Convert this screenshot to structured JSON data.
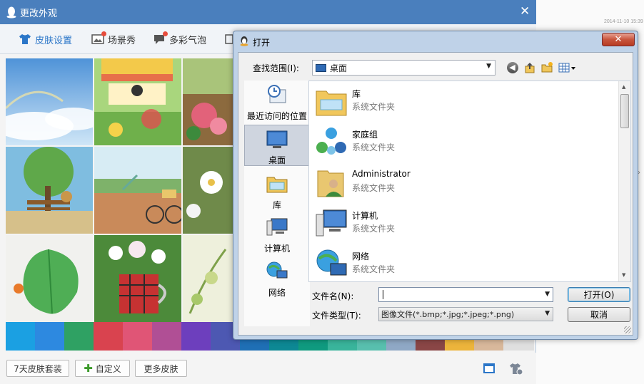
{
  "skin_window": {
    "title": "更改外观",
    "tabs": [
      {
        "label": "皮肤设置"
      },
      {
        "label": "场景秀"
      },
      {
        "label": "多彩气泡"
      }
    ],
    "bottom_buttons": {
      "seven_day": "7天皮肤套装",
      "custom": "自定义",
      "more": "更多皮肤"
    },
    "colors": [
      "#1ba0e2",
      "#2d89e0",
      "#2fa163",
      "#d9434f",
      "#e05576",
      "#b04f95",
      "#6d3fbd",
      "#4d58b2",
      "#1f6fb5",
      "#0d8894",
      "#0f9a7f",
      "#39b49b",
      "#58bfae",
      "#8fa8c5",
      "#8a4646",
      "#ecb43b",
      "#d8b89b",
      "#dfdfdf"
    ]
  },
  "background": {
    "timestamp": "2014-11-10  15:39"
  },
  "open_dialog": {
    "title": "打开",
    "look_in_label": "查找范围(I):",
    "look_in_value": "桌面",
    "places": [
      {
        "label": "最近访问的位置"
      },
      {
        "label": "桌面"
      },
      {
        "label": "库"
      },
      {
        "label": "计算机"
      },
      {
        "label": "网络"
      }
    ],
    "files": [
      {
        "name": "库",
        "type": "系统文件夹"
      },
      {
        "name": "家庭组",
        "type": "系统文件夹"
      },
      {
        "name": "Administrator",
        "type": "系统文件夹"
      },
      {
        "name": "计算机",
        "type": "系统文件夹"
      },
      {
        "name": "网络",
        "type": "系统文件夹"
      }
    ],
    "filename_label": "文件名(N):",
    "filename_value": "",
    "filetype_label": "文件类型(T):",
    "filetype_value": "图像文件(*.bmp;*.jpg;*.jpeg;*.png)",
    "open_button": "打开(O)",
    "cancel_button": "取消"
  }
}
